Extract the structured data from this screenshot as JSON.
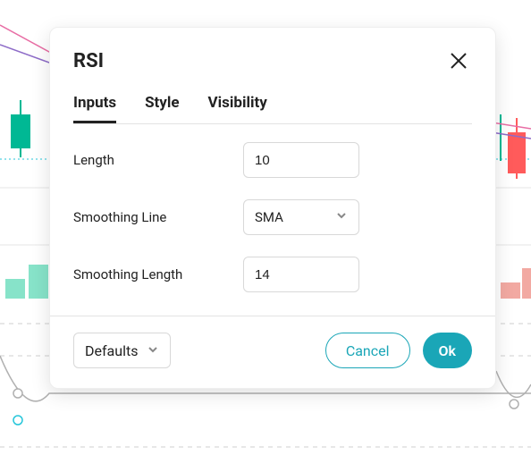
{
  "modal": {
    "title": "RSI",
    "tabs": [
      {
        "label": "Inputs",
        "active": true
      },
      {
        "label": "Style",
        "active": false
      },
      {
        "label": "Visibility",
        "active": false
      }
    ],
    "fields": {
      "length": {
        "label": "Length",
        "value": "10"
      },
      "smoothing_line": {
        "label": "Smoothing Line",
        "value": "SMA"
      },
      "smoothing_length": {
        "label": "Smoothing Length",
        "value": "14"
      }
    },
    "footer": {
      "defaults_label": "Defaults",
      "cancel_label": "Cancel",
      "ok_label": "Ok"
    }
  }
}
